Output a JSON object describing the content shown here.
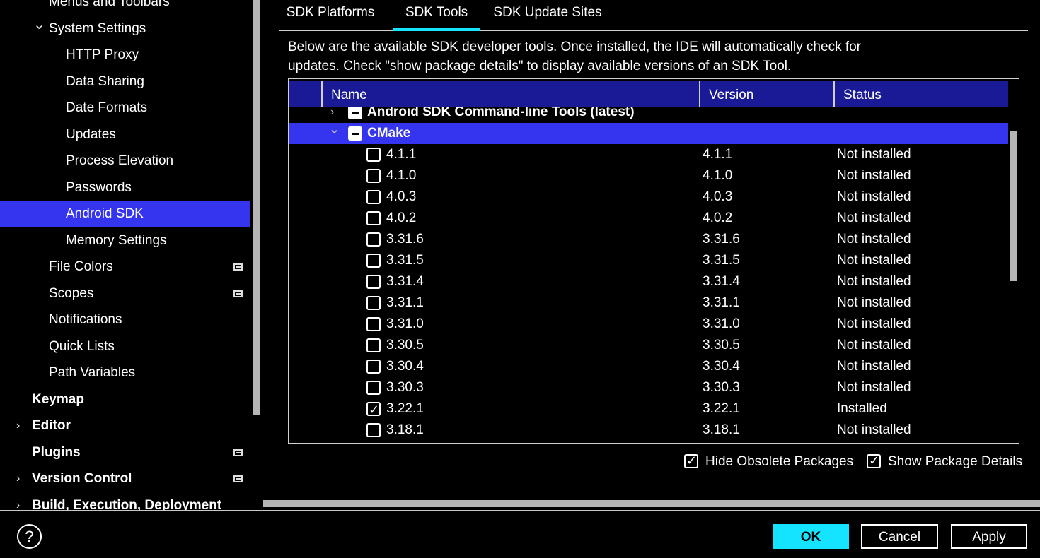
{
  "sidebar": {
    "items": [
      {
        "label": "Menus and Toolbars",
        "indent": 1
      },
      {
        "label": "System Settings",
        "indent": 1,
        "chevron": "expanded"
      },
      {
        "label": "HTTP Proxy",
        "indent": 2
      },
      {
        "label": "Data Sharing",
        "indent": 2
      },
      {
        "label": "Date Formats",
        "indent": 2
      },
      {
        "label": "Updates",
        "indent": 2
      },
      {
        "label": "Process Elevation",
        "indent": 2
      },
      {
        "label": "Passwords",
        "indent": 2
      },
      {
        "label": "Android SDK",
        "indent": 2,
        "selected": true
      },
      {
        "label": "Memory Settings",
        "indent": 2
      },
      {
        "label": "File Colors",
        "indent": 1,
        "project_icon": true
      },
      {
        "label": "Scopes",
        "indent": 1,
        "project_icon": true
      },
      {
        "label": "Notifications",
        "indent": 1
      },
      {
        "label": "Quick Lists",
        "indent": 1
      },
      {
        "label": "Path Variables",
        "indent": 1
      },
      {
        "label": "Keymap",
        "indent": 0,
        "bold": true
      },
      {
        "label": "Editor",
        "indent": 0,
        "bold": true,
        "chevron": "collapsed"
      },
      {
        "label": "Plugins",
        "indent": 0,
        "bold": true,
        "project_icon": true
      },
      {
        "label": "Version Control",
        "indent": 0,
        "bold": true,
        "chevron": "collapsed",
        "project_icon": true
      },
      {
        "label": "Build, Execution, Deployment",
        "indent": 0,
        "bold": true,
        "chevron": "collapsed"
      }
    ]
  },
  "tabs": [
    {
      "label": "SDK Platforms",
      "active": false
    },
    {
      "label": "SDK Tools",
      "active": true
    },
    {
      "label": "SDK Update Sites",
      "active": false
    }
  ],
  "description": "Below are the available SDK developer tools. Once installed, the IDE will automatically check for updates. Check \"show package details\" to display available versions of an SDK Tool.",
  "table": {
    "columns": [
      "Name",
      "Version",
      "Status"
    ],
    "groups": [
      {
        "name": "Android SDK Command-line Tools (latest)",
        "expanded": false,
        "checkbox": "partial"
      },
      {
        "name": "CMake",
        "expanded": true,
        "checkbox": "partial",
        "selected": true
      }
    ],
    "rows": [
      {
        "name": "4.1.1",
        "version": "4.1.1",
        "status": "Not installed",
        "checked": false
      },
      {
        "name": "4.1.0",
        "version": "4.1.0",
        "status": "Not installed",
        "checked": false
      },
      {
        "name": "4.0.3",
        "version": "4.0.3",
        "status": "Not installed",
        "checked": false
      },
      {
        "name": "4.0.2",
        "version": "4.0.2",
        "status": "Not installed",
        "checked": false
      },
      {
        "name": "3.31.6",
        "version": "3.31.6",
        "status": "Not installed",
        "checked": false
      },
      {
        "name": "3.31.5",
        "version": "3.31.5",
        "status": "Not installed",
        "checked": false
      },
      {
        "name": "3.31.4",
        "version": "3.31.4",
        "status": "Not installed",
        "checked": false
      },
      {
        "name": "3.31.1",
        "version": "3.31.1",
        "status": "Not installed",
        "checked": false
      },
      {
        "name": "3.31.0",
        "version": "3.31.0",
        "status": "Not installed",
        "checked": false
      },
      {
        "name": "3.30.5",
        "version": "3.30.5",
        "status": "Not installed",
        "checked": false
      },
      {
        "name": "3.30.4",
        "version": "3.30.4",
        "status": "Not installed",
        "checked": false
      },
      {
        "name": "3.30.3",
        "version": "3.30.3",
        "status": "Not installed",
        "checked": false
      },
      {
        "name": "3.22.1",
        "version": "3.22.1",
        "status": "Installed",
        "checked": true
      },
      {
        "name": "3.18.1",
        "version": "3.18.1",
        "status": "Not installed",
        "checked": false
      }
    ]
  },
  "options": {
    "hide_obsolete": {
      "label": "Hide Obsolete Packages",
      "checked": true
    },
    "show_details": {
      "label": "Show Package Details",
      "checked": true
    }
  },
  "footer": {
    "help": "?",
    "ok_label": "OK",
    "cancel_label": "Cancel",
    "apply_label": "Apply"
  },
  "colors": {
    "accent": "#14e4ff",
    "selection": "#3535f0",
    "header": "#1a1a96",
    "background": "#000000"
  }
}
